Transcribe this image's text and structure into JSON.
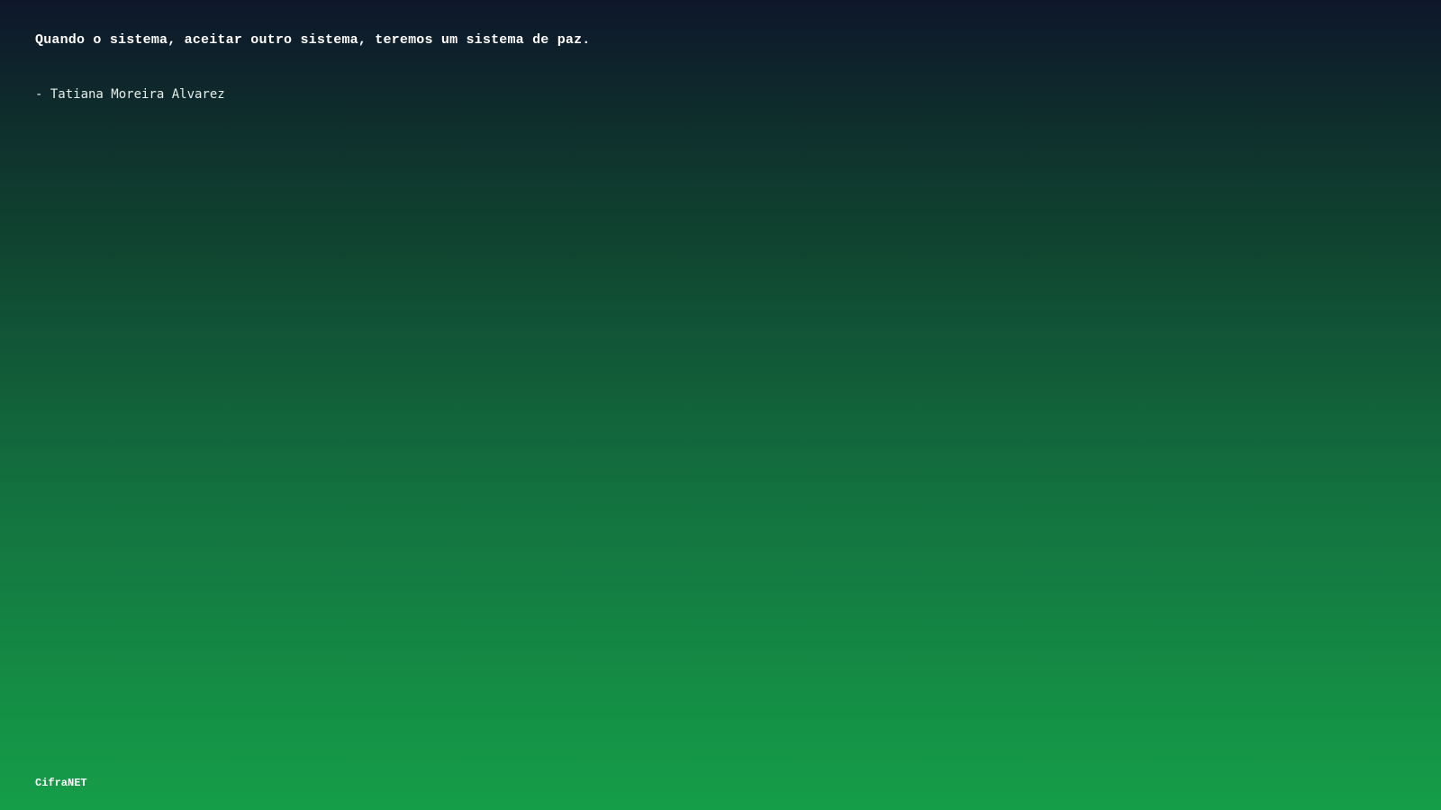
{
  "quote": {
    "text": "Quando o sistema, aceitar outro sistema, teremos um sistema de paz.",
    "author": "- Tatiana Moreira Alvarez"
  },
  "brand": {
    "name": "CifraNET"
  },
  "colors": {
    "gradient_top": "#0e172a",
    "gradient_bottom": "#159e48",
    "text": "#ffffff"
  }
}
